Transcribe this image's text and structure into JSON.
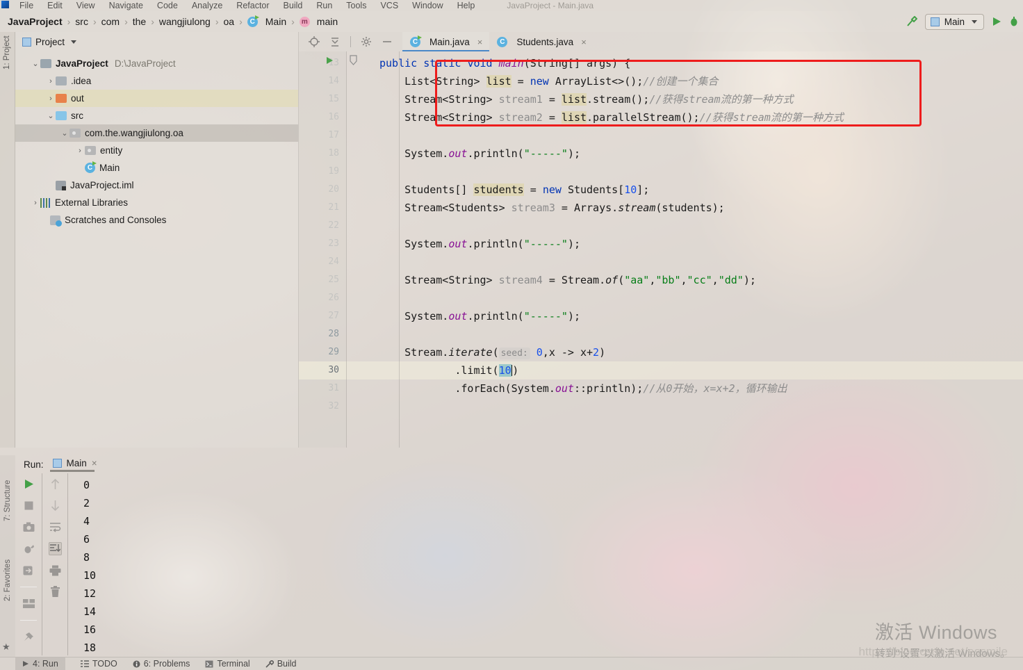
{
  "window": {
    "title": "JavaProject - Main.java",
    "menu": [
      "File",
      "Edit",
      "View",
      "Navigate",
      "Code",
      "Analyze",
      "Refactor",
      "Build",
      "Run",
      "Tools",
      "VCS",
      "Window",
      "Help"
    ]
  },
  "breadcrumb": {
    "items": [
      {
        "label": "JavaProject",
        "icon": "",
        "bold": true
      },
      {
        "label": "src",
        "icon": ""
      },
      {
        "label": "com",
        "icon": ""
      },
      {
        "label": "the",
        "icon": ""
      },
      {
        "label": "wangjiulong",
        "icon": ""
      },
      {
        "label": "oa",
        "icon": ""
      },
      {
        "label": "Main",
        "icon": "class-icon"
      },
      {
        "label": "main",
        "icon": "method-icon"
      }
    ],
    "separator": "›"
  },
  "toolbar": {
    "run_config_label": "Main",
    "build_icon": "hammer-icon",
    "run_icon": "run-triangle-icon",
    "debug_icon": "debug-bug-icon"
  },
  "project_panel": {
    "title": "Project",
    "rail_label": "1: Project",
    "tree": [
      {
        "label": "JavaProject",
        "path": "D:\\JavaProject",
        "arrow": "⌄",
        "icon": "module-icon",
        "depth": 0,
        "bold": true
      },
      {
        "label": ".idea",
        "arrow": "›",
        "icon": "folder-grey-icon",
        "depth": 1
      },
      {
        "label": "out",
        "arrow": "›",
        "icon": "folder-orange-icon",
        "depth": 1,
        "state": "highlighted"
      },
      {
        "label": "src",
        "arrow": "⌄",
        "icon": "folder-blue-icon",
        "depth": 1
      },
      {
        "label": "com.the.wangjiulong.oa",
        "arrow": "⌄",
        "icon": "package-icon",
        "depth": 2,
        "state": "selected"
      },
      {
        "label": "entity",
        "arrow": "›",
        "icon": "package-icon",
        "depth": 3
      },
      {
        "label": "Main",
        "arrow": "",
        "icon": "java-class-run-icon",
        "depth": 3
      },
      {
        "label": "JavaProject.iml",
        "arrow": "",
        "icon": "iml-file-icon",
        "depth": 1
      },
      {
        "label": "External Libraries",
        "arrow": "›",
        "icon": "libraries-icon",
        "depth": 0
      },
      {
        "label": "Scratches and Consoles",
        "arrow": "",
        "icon": "scratches-icon",
        "depth": 0
      }
    ]
  },
  "editor": {
    "tabs": [
      {
        "label": "Main.java",
        "icon": "java-class-run-icon",
        "active": true,
        "close": "×"
      },
      {
        "label": "Students.java",
        "icon": "java-class-icon",
        "active": false,
        "close": "×"
      }
    ],
    "tab_icons": [
      "locate-icon",
      "collapse-all-icon",
      "settings-gear-icon",
      "hide-minus-icon"
    ],
    "line_numbers": [
      "13",
      "14",
      "15",
      "16",
      "17",
      "18",
      "19",
      "20",
      "21",
      "22",
      "23",
      "24",
      "25",
      "26",
      "27",
      "28",
      "29",
      "30",
      "31",
      "32"
    ],
    "current_line": "30",
    "code_lines": [
      {
        "n": "13",
        "segments": [
          {
            "t": "public ",
            "c": "k"
          },
          {
            "t": "static ",
            "c": "k"
          },
          {
            "t": "void ",
            "c": "k"
          },
          {
            "t": "main",
            "c": "pur"
          },
          {
            "t": "(String[] args) {",
            "c": ""
          }
        ]
      },
      {
        "n": "14",
        "segments": [
          {
            "t": "    List<String> ",
            "c": ""
          },
          {
            "t": "list",
            "c": "hlw"
          },
          {
            "t": " = ",
            "c": ""
          },
          {
            "t": "new ",
            "c": "k"
          },
          {
            "t": "ArrayList<>();",
            "c": ""
          },
          {
            "t": "//创建一个集合",
            "c": "c"
          }
        ]
      },
      {
        "n": "15",
        "segments": [
          {
            "t": "    Stream<String> ",
            "c": ""
          },
          {
            "t": "stream1",
            "c": "f"
          },
          {
            "t": " = ",
            "c": ""
          },
          {
            "t": "list",
            "c": "hlw"
          },
          {
            "t": ".stream();",
            "c": ""
          },
          {
            "t": "//获得stream流的第一种方式",
            "c": "c"
          }
        ]
      },
      {
        "n": "16",
        "segments": [
          {
            "t": "    Stream<String> ",
            "c": ""
          },
          {
            "t": "stream2",
            "c": "f"
          },
          {
            "t": " = ",
            "c": ""
          },
          {
            "t": "list",
            "c": "hlw"
          },
          {
            "t": ".parallelStream();",
            "c": ""
          },
          {
            "t": "//获得stream流的第一种方式",
            "c": "c"
          }
        ]
      },
      {
        "n": "17",
        "segments": []
      },
      {
        "n": "18",
        "segments": [
          {
            "t": "    System.",
            "c": ""
          },
          {
            "t": "out",
            "c": "pur"
          },
          {
            "t": ".println(",
            "c": ""
          },
          {
            "t": "\"-----\"",
            "c": "s"
          },
          {
            "t": ");",
            "c": ""
          }
        ]
      },
      {
        "n": "19",
        "segments": []
      },
      {
        "n": "20",
        "segments": [
          {
            "t": "    Students[] ",
            "c": ""
          },
          {
            "t": "students",
            "c": "hlw"
          },
          {
            "t": " = ",
            "c": ""
          },
          {
            "t": "new ",
            "c": "k"
          },
          {
            "t": "Students[",
            "c": ""
          },
          {
            "t": "10",
            "c": "n"
          },
          {
            "t": "];",
            "c": ""
          }
        ]
      },
      {
        "n": "21",
        "segments": [
          {
            "t": "    Stream<Students> ",
            "c": ""
          },
          {
            "t": "stream3",
            "c": "f"
          },
          {
            "t": " = Arrays.",
            "c": ""
          },
          {
            "t": "stream",
            "c": "it"
          },
          {
            "t": "(students);",
            "c": ""
          }
        ]
      },
      {
        "n": "22",
        "segments": []
      },
      {
        "n": "23",
        "segments": [
          {
            "t": "    System.",
            "c": ""
          },
          {
            "t": "out",
            "c": "pur"
          },
          {
            "t": ".println(",
            "c": ""
          },
          {
            "t": "\"-----\"",
            "c": "s"
          },
          {
            "t": ");",
            "c": ""
          }
        ]
      },
      {
        "n": "24",
        "segments": []
      },
      {
        "n": "25",
        "segments": [
          {
            "t": "    Stream<String> ",
            "c": ""
          },
          {
            "t": "stream4",
            "c": "f"
          },
          {
            "t": " = Stream.",
            "c": ""
          },
          {
            "t": "of",
            "c": "it"
          },
          {
            "t": "(",
            "c": ""
          },
          {
            "t": "\"aa\"",
            "c": "s"
          },
          {
            "t": ",",
            "c": ""
          },
          {
            "t": "\"bb\"",
            "c": "s"
          },
          {
            "t": ",",
            "c": ""
          },
          {
            "t": "\"cc\"",
            "c": "s"
          },
          {
            "t": ",",
            "c": ""
          },
          {
            "t": "\"dd\"",
            "c": "s"
          },
          {
            "t": ");",
            "c": ""
          }
        ]
      },
      {
        "n": "26",
        "segments": []
      },
      {
        "n": "27",
        "segments": [
          {
            "t": "    System.",
            "c": ""
          },
          {
            "t": "out",
            "c": "pur"
          },
          {
            "t": ".println(",
            "c": ""
          },
          {
            "t": "\"-----\"",
            "c": "s"
          },
          {
            "t": ");",
            "c": ""
          }
        ]
      },
      {
        "n": "28",
        "segments": []
      },
      {
        "n": "29",
        "segments": [
          {
            "t": "    Stream.",
            "c": ""
          },
          {
            "t": "iterate",
            "c": "it"
          },
          {
            "t": "(",
            "c": ""
          },
          {
            "t": "seed:",
            "c": "hint"
          },
          {
            "t": " ",
            "c": ""
          },
          {
            "t": "0",
            "c": "n"
          },
          {
            "t": ",x -> x+",
            "c": ""
          },
          {
            "t": "2",
            "c": "n"
          },
          {
            "t": ")",
            "c": ""
          }
        ]
      },
      {
        "n": "30",
        "segments": [
          {
            "t": "            .limit(",
            "c": ""
          },
          {
            "t": "10",
            "c": "sel10"
          },
          {
            "t": ")",
            "c": ""
          }
        ]
      },
      {
        "n": "31",
        "segments": [
          {
            "t": "            .forEach(System.",
            "c": ""
          },
          {
            "t": "out",
            "c": "pur"
          },
          {
            "t": "::println);",
            "c": ""
          },
          {
            "t": "//从0开始，x=x+2，循环输出",
            "c": "c"
          }
        ]
      },
      {
        "n": "32",
        "segments": []
      }
    ],
    "annotation": {
      "type": "red-rectangle",
      "color": "#ee1c1c"
    }
  },
  "run_panel": {
    "label": "Run:",
    "tab_label": "Main",
    "tab_close": "×",
    "rail_labels": [
      "7: Structure",
      "2: Favorites"
    ],
    "tools_left": [
      "rerun-icon",
      "stop-icon",
      "camera-icon",
      "debug-icon",
      "export-icon",
      "layout-icon",
      "pin-icon"
    ],
    "tools_right": [
      "up-arrow-icon",
      "down-arrow-icon",
      "soft-wrap-icon",
      "scroll-to-end-icon",
      "print-icon",
      "trash-icon"
    ],
    "console_output": [
      "0",
      "2",
      "4",
      "6",
      "8",
      "10",
      "12",
      "14",
      "16",
      "18"
    ]
  },
  "statusbar": {
    "items": [
      {
        "label": "4: Run",
        "icon": "run-triangle-icon",
        "selected": true
      },
      {
        "label": "TODO",
        "icon": "todo-list-icon"
      },
      {
        "label": "6: Problems",
        "icon": "problems-icon"
      },
      {
        "label": "Terminal",
        "icon": "terminal-icon"
      },
      {
        "label": "Build",
        "icon": "build-hammer-icon"
      }
    ]
  },
  "watermark": {
    "line1": "激活 Windows",
    "line2": "转到“设置”以激活 Windows。",
    "url": "https://blog.csdn.net/essmile"
  },
  "colors": {
    "accent": "#4a88c7",
    "annotation": "#ee1c1c",
    "run_green": "#43a047",
    "keyword": "#0033b3",
    "string": "#067d17",
    "number": "#1750eb",
    "comment": "#8c8c8c"
  }
}
